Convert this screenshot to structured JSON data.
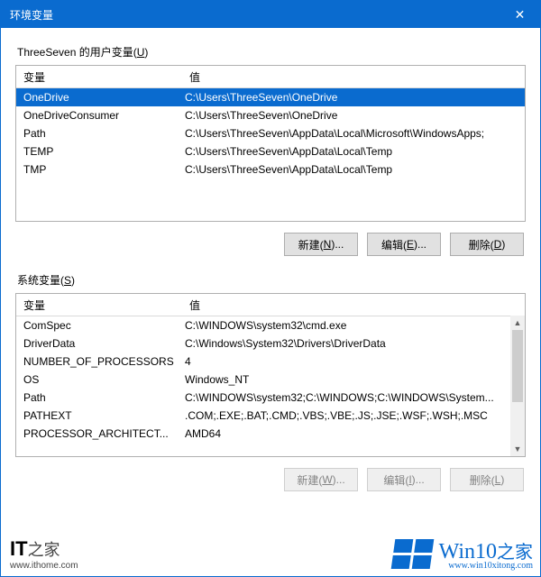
{
  "window": {
    "title": "环境变量"
  },
  "user": {
    "label_prefix": "ThreeSeven 的用户变量(",
    "label_u": "U",
    "label_suffix": ")",
    "cols": {
      "name": "变量",
      "value": "值"
    },
    "rows": [
      {
        "name": "OneDrive",
        "value": "C:\\Users\\ThreeSeven\\OneDrive",
        "selected": true
      },
      {
        "name": "OneDriveConsumer",
        "value": "C:\\Users\\ThreeSeven\\OneDrive"
      },
      {
        "name": "Path",
        "value": "C:\\Users\\ThreeSeven\\AppData\\Local\\Microsoft\\WindowsApps;"
      },
      {
        "name": "TEMP",
        "value": "C:\\Users\\ThreeSeven\\AppData\\Local\\Temp"
      },
      {
        "name": "TMP",
        "value": "C:\\Users\\ThreeSeven\\AppData\\Local\\Temp"
      }
    ],
    "buttons": {
      "new": {
        "t": "新建(",
        "u": "N",
        "s": ")..."
      },
      "edit": {
        "t": "编辑(",
        "u": "E",
        "s": ")..."
      },
      "del": {
        "t": "删除(",
        "u": "D",
        "s": ")"
      }
    }
  },
  "sys": {
    "label_prefix": "系统变量(",
    "label_u": "S",
    "label_suffix": ")",
    "cols": {
      "name": "变量",
      "value": "值"
    },
    "rows": [
      {
        "name": "ComSpec",
        "value": "C:\\WINDOWS\\system32\\cmd.exe"
      },
      {
        "name": "DriverData",
        "value": "C:\\Windows\\System32\\Drivers\\DriverData"
      },
      {
        "name": "NUMBER_OF_PROCESSORS",
        "value": "4"
      },
      {
        "name": "OS",
        "value": "Windows_NT"
      },
      {
        "name": "Path",
        "value": "C:\\WINDOWS\\system32;C:\\WINDOWS;C:\\WINDOWS\\System..."
      },
      {
        "name": "PATHEXT",
        "value": ".COM;.EXE;.BAT;.CMD;.VBS;.VBE;.JS;.JSE;.WSF;.WSH;.MSC"
      },
      {
        "name": "PROCESSOR_ARCHITECT...",
        "value": "AMD64"
      }
    ],
    "buttons": {
      "new": {
        "t": "新建(",
        "u": "W",
        "s": ")..."
      },
      "edit": {
        "t": "编辑(",
        "u": "I",
        "s": ")..."
      },
      "del": {
        "t": "删除(",
        "u": "L",
        "s": ")"
      }
    }
  },
  "watermark": {
    "left_brand": "IT",
    "left_cn": "之家",
    "left_url": "www.ithome.com",
    "right_brand": "Win10",
    "right_cn": "之家",
    "right_url": "www.win10xitong.com"
  }
}
